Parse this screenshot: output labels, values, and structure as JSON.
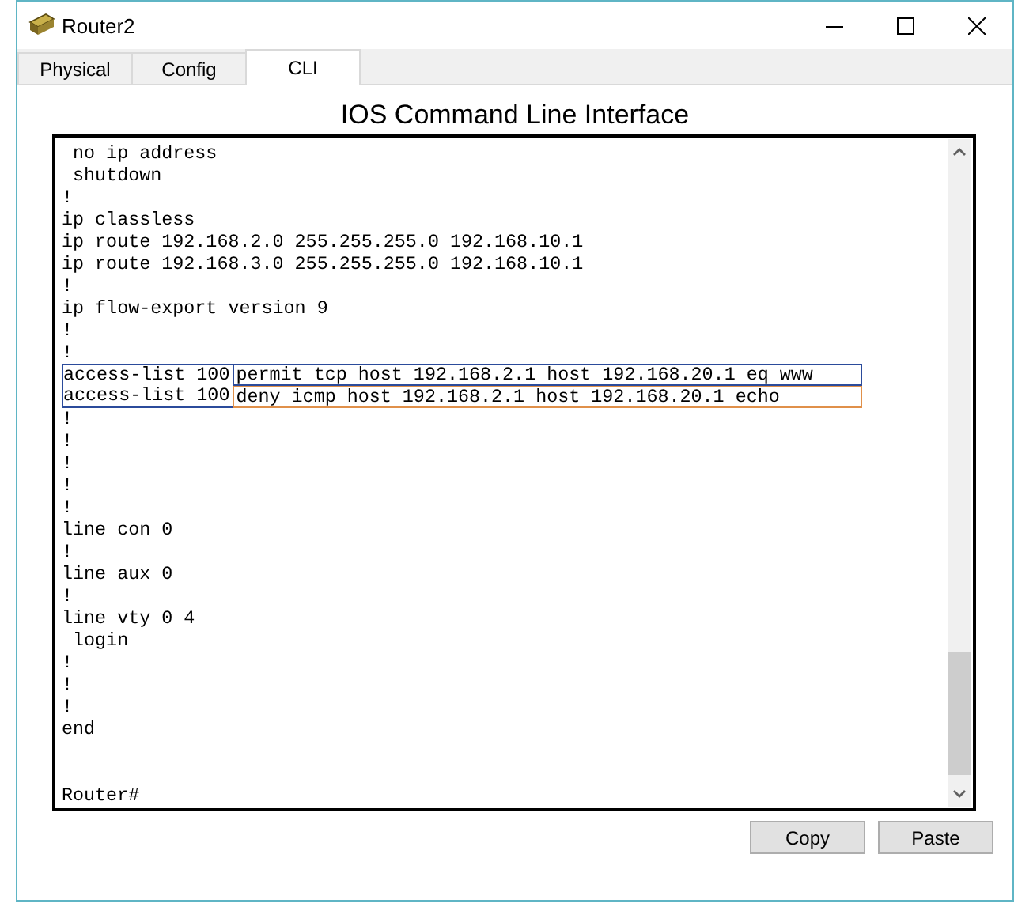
{
  "window": {
    "title": "Router2"
  },
  "tabs": [
    {
      "label": "Physical",
      "selected": false
    },
    {
      "label": "Config",
      "selected": false
    },
    {
      "label": "CLI",
      "selected": true
    }
  ],
  "heading": "IOS Command Line Interface",
  "terminal": {
    "lines": [
      {
        "text": " no ip address"
      },
      {
        "text": " shutdown"
      },
      {
        "text": "!"
      },
      {
        "text": "ip classless"
      },
      {
        "text": "ip route 192.168.2.0 255.255.255.0 192.168.10.1"
      },
      {
        "text": "ip route 192.168.3.0 255.255.255.0 192.168.10.1"
      },
      {
        "text": "!"
      },
      {
        "text": "ip flow-export version 9"
      },
      {
        "text": "!"
      },
      {
        "text": "!"
      },
      {
        "kind": "acl",
        "keyword": "access-list 100",
        "rule": "permit tcp host 192.168.2.1 host 192.168.20.1 eq www",
        "color": "#2b4b9b"
      },
      {
        "kind": "acl",
        "keyword": "access-list 100",
        "rule": "deny icmp host 192.168.2.1 host 192.168.20.1 echo",
        "color": "#e0904a"
      },
      {
        "text": "!"
      },
      {
        "text": "!"
      },
      {
        "text": "!"
      },
      {
        "text": "!"
      },
      {
        "text": "!"
      },
      {
        "text": "line con 0"
      },
      {
        "text": "!"
      },
      {
        "text": "line aux 0"
      },
      {
        "text": "!"
      },
      {
        "text": "line vty 0 4"
      },
      {
        "text": " login"
      },
      {
        "text": "!"
      },
      {
        "text": "!"
      },
      {
        "text": "!"
      },
      {
        "text": "end"
      },
      {
        "kind": "blank"
      },
      {
        "kind": "blank"
      },
      {
        "text": "Router#"
      }
    ]
  },
  "buttons": [
    "Copy",
    "Paste"
  ]
}
